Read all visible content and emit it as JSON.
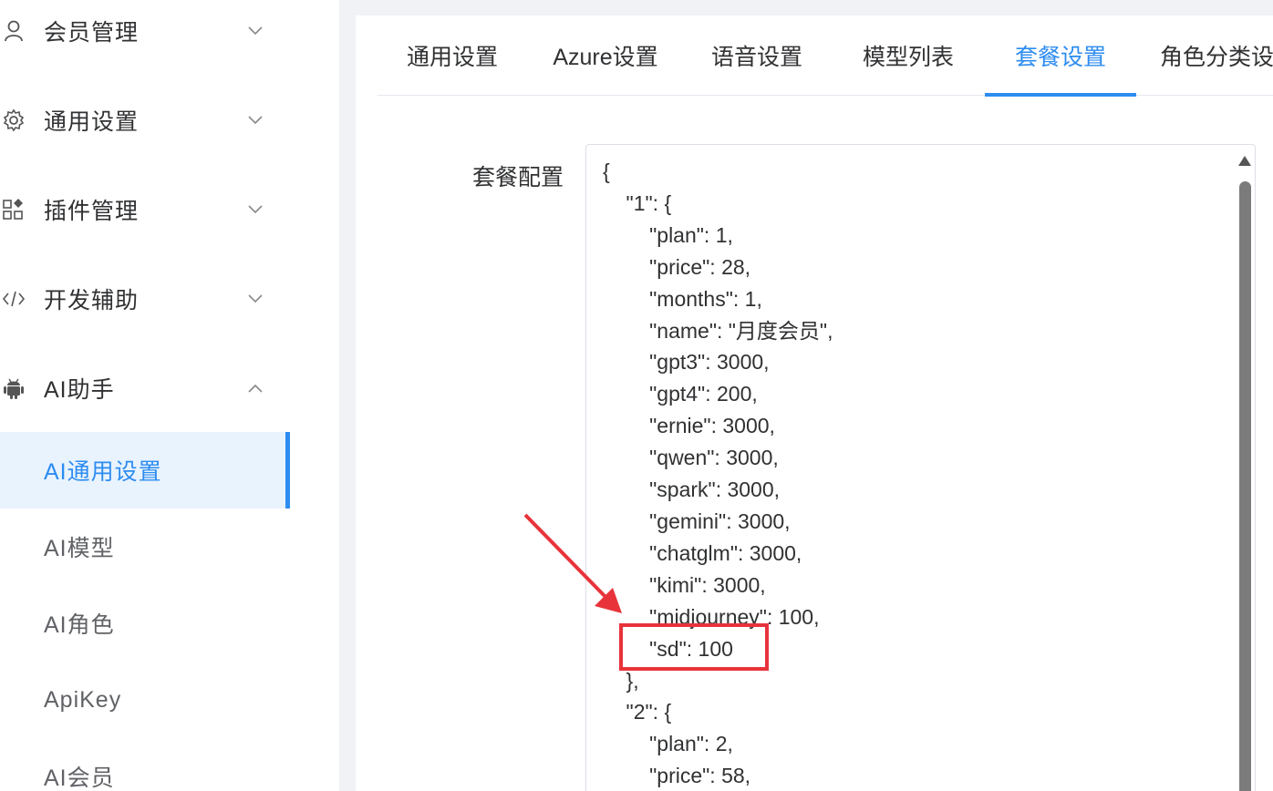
{
  "sidebar": {
    "menus": [
      {
        "label": "会员管理",
        "icon": "user-icon",
        "expanded": false
      },
      {
        "label": "通用设置",
        "icon": "gear-icon",
        "expanded": false
      },
      {
        "label": "插件管理",
        "icon": "plugin-icon",
        "expanded": false
      },
      {
        "label": "开发辅助",
        "icon": "code-icon",
        "expanded": false
      },
      {
        "label": "AI助手",
        "icon": "android-icon",
        "expanded": true
      }
    ],
    "sub_items": [
      {
        "label": "AI通用设置",
        "active": true
      },
      {
        "label": "AI模型",
        "active": false
      },
      {
        "label": "AI角色",
        "active": false
      },
      {
        "label": "ApiKey",
        "active": false
      },
      {
        "label": "AI会员",
        "active": false
      }
    ]
  },
  "tabs": [
    {
      "label": "通用设置",
      "active": false
    },
    {
      "label": "Azure设置",
      "active": false
    },
    {
      "label": "语音设置",
      "active": false
    },
    {
      "label": "模型列表",
      "active": false
    },
    {
      "label": "套餐设置",
      "active": true
    },
    {
      "label": "角色分类设",
      "active": false
    }
  ],
  "form": {
    "label": "套餐配置",
    "code_lines": [
      "{",
      "    \"1\": {",
      "        \"plan\": 1,",
      "        \"price\": 28,",
      "        \"months\": 1,",
      "        \"name\": \"月度会员\",",
      "        \"gpt3\": 3000,",
      "        \"gpt4\": 200,",
      "        \"ernie\": 3000,",
      "        \"qwen\": 3000,",
      "        \"spark\": 3000,",
      "        \"gemini\": 3000,",
      "        \"chatglm\": 3000,",
      "        \"kimi\": 3000,",
      "        \"midjourney\": 100,",
      "        \"sd\": 100",
      "    },",
      "    \"2\": {",
      "        \"plan\": 2,",
      "        \"price\": 58,"
    ]
  },
  "colors": {
    "accent": "#2d8cf0",
    "annotation": "#e8333a"
  }
}
